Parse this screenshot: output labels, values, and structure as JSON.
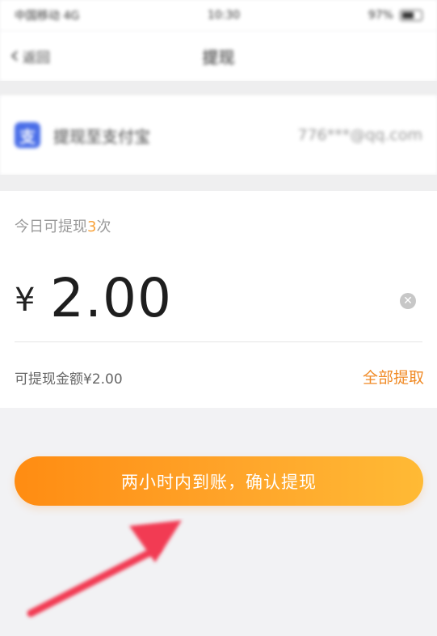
{
  "status_bar": {
    "carrier": "中国移动 4G",
    "time": "10:30",
    "battery": "97%"
  },
  "navbar": {
    "back_label": "返回",
    "title": "提现"
  },
  "account": {
    "label": "提现至支付宝",
    "value": "776***@qq.com"
  },
  "withdraw": {
    "times_prefix": "今日可提现",
    "times_count": "3",
    "times_suffix": "次",
    "currency": "¥",
    "amount": "2.00",
    "available_text": "可提现金额¥2.00",
    "withdraw_all_label": "全部提取"
  },
  "confirm_button": {
    "label": "两小时内到账，确认提现"
  },
  "colors": {
    "accent": "#F08A25",
    "button_start": "#FF8C12",
    "button_end": "#FFBA35",
    "alipay_blue": "#4A6EE8",
    "arrow": "#F23A52"
  },
  "icons": {
    "back": "chevron-left-icon",
    "account": "alipay-icon",
    "clear": "clear-icon",
    "annotation": "arrow-annotation"
  }
}
